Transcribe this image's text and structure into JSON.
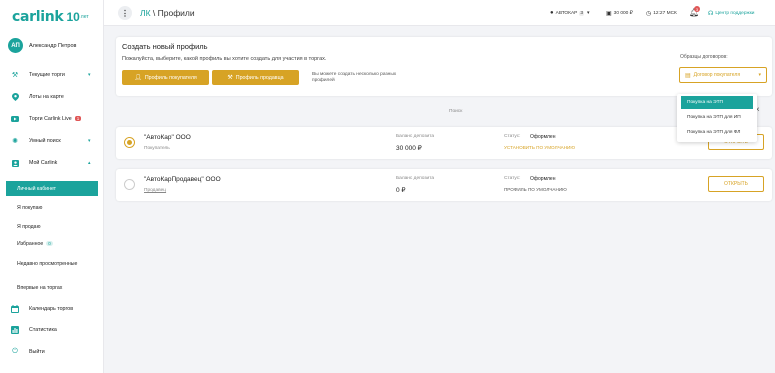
{
  "logo": {
    "text": "carlink",
    "number": "10",
    "suffix": "лет"
  },
  "user": {
    "initials": "АП",
    "name": "Александр Петров"
  },
  "sidebar": {
    "items": [
      {
        "label": "Текущие торги",
        "icon": "hammer-icon"
      },
      {
        "label": "Лоты на карте",
        "icon": "map-pin-icon"
      },
      {
        "label": "Торги Carlink Live",
        "icon": "live-icon",
        "badge": "1"
      },
      {
        "label": "Умный поиск",
        "icon": "bulb-icon"
      },
      {
        "label": "Мой Carlink",
        "icon": "profile-icon"
      }
    ],
    "sub_items": [
      {
        "label": "Личный кабинет"
      },
      {
        "label": "Я покупаю"
      },
      {
        "label": "Я продаю"
      },
      {
        "label": "Избранное",
        "badge": "0"
      },
      {
        "label": "Недавно просмотренные"
      },
      {
        "label": "Впервые на торгах"
      }
    ],
    "bottom_items": [
      {
        "label": "Календарь торгов",
        "icon": "calendar-icon"
      },
      {
        "label": "Статистика",
        "icon": "stats-icon"
      },
      {
        "label": "Выйти",
        "icon": "power-icon"
      }
    ]
  },
  "topbar": {
    "breadcrumb_root": "ЛК",
    "breadcrumb_sep": " \\ ",
    "breadcrumb_current": "Профили",
    "account": "АВТОКАР",
    "account_badge": "3",
    "balance": "30 000 ₽",
    "time": "12:27 МСК",
    "notif_count": "3",
    "support": "Центр поддержки"
  },
  "create": {
    "title": "Создать новый профиль",
    "desc": "Пожалуйста, выберите, какой профиль вы хотите создать для участия в торгах.",
    "buyer_btn": "Профиль покупателя",
    "seller_btn": "Профиль продавца",
    "note": "Вы можете создать несколько разных профилей",
    "samples_label": "Образцы договоров:",
    "select_value": "Договор покупателя"
  },
  "dropdown": {
    "options": [
      "Покупка на ЭТП",
      "Покупка на ЭТП для ИП",
      "Покупка на ЭТП для ФЛ"
    ]
  },
  "search_label": "Поиск",
  "profiles": [
    {
      "name": "\"АвтоКар\" ООО",
      "role": "Покупатель",
      "balance_label": "Баланс депозита",
      "balance": "30 000 ₽",
      "status_label": "Статус:",
      "status": "Оформлен",
      "status_action": "УСТАНОВИТЬ ПО УМОЛЧАНИЮ",
      "selected": true,
      "open_label": "ОТКРЫТЬ"
    },
    {
      "name": "\"АвтоКарПродавец\" ООО",
      "role": "Продавец",
      "balance_label": "Баланс депозита",
      "balance": "0 ₽",
      "status_label": "Статус:",
      "status": "Оформлен",
      "status_action": "ПРОФИЛЬ ПО УМОЛЧАНИЮ",
      "selected": false,
      "open_label": "ОТКРЫТЬ"
    }
  ],
  "colors": {
    "accent": "#1ba39c",
    "gold": "#d7a325"
  }
}
